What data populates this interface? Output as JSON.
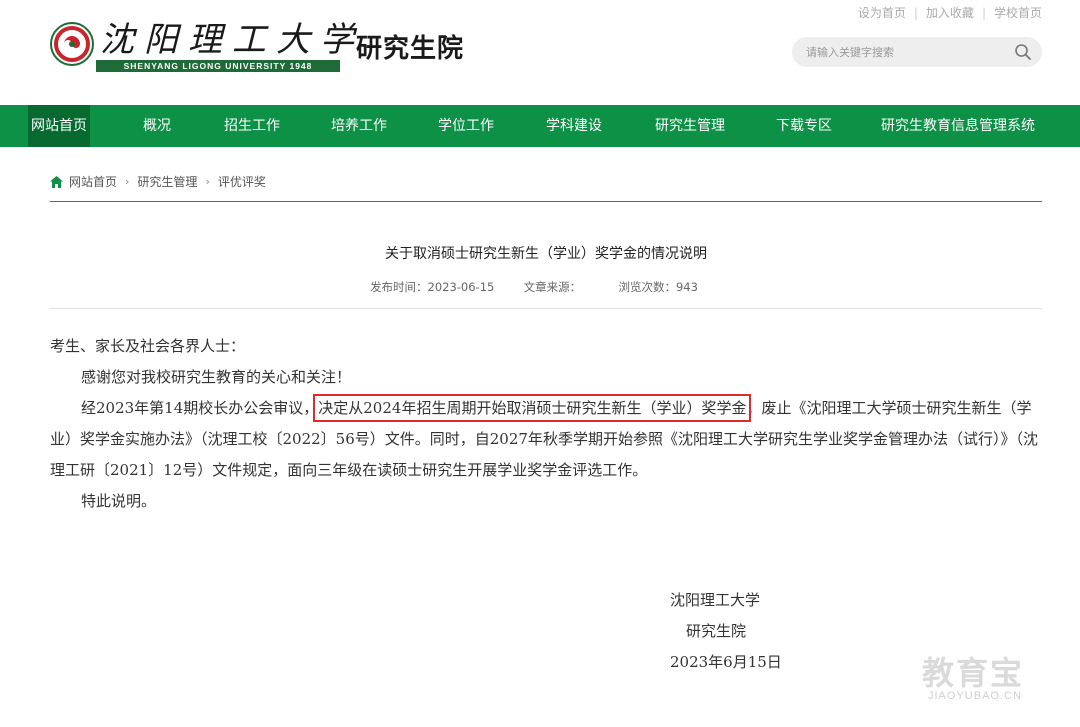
{
  "top_links": [
    "设为首页",
    "加入收藏",
    "学校首页"
  ],
  "logo": {
    "cn": "沈阳理工大学",
    "en": "SHENYANG LIGONG UNIVERSITY 1948",
    "emblem": "university-emblem"
  },
  "site_name": "研究生院",
  "search": {
    "placeholder": "请输入关键字搜索",
    "icon": "search-icon"
  },
  "colors": {
    "nav_green": "#0d9146",
    "nav_active": "#076a31",
    "highlight_red": "#e12b2b"
  },
  "nav": {
    "items": [
      "网站首页",
      "概况",
      "招生工作",
      "培养工作",
      "学位工作",
      "学科建设",
      "研究生管理",
      "下载专区",
      "研究生教育信息管理系统"
    ],
    "active": "网站首页"
  },
  "breadcrumb": {
    "icon": "home-icon",
    "items": [
      "网站首页",
      "研究生管理",
      "评优评奖"
    ]
  },
  "article": {
    "title": "关于取消硕士研究生新生（学业）奖学金的情况说明",
    "publish_time": "发布时间：2023-06-15",
    "source": "文章来源：",
    "views": "浏览次数：943",
    "salutation": "考生、家长及社会各界人士：",
    "para1": "感谢您对我校研究生教育的关心和关注！",
    "para2_pre": "经2023年第14期校长办公会审议，",
    "para2_highlight": "决定从2024年招生周期开始取消硕士研究生新生（学业）奖学金",
    "para2_post": "，废止《沈阳理工大学硕士研究生新生（学业）奖学金实施办法》（沈理工校〔2022〕56号）文件。同时，自2027年秋季学期开始参照《沈阳理工大学研究生学业奖学金管理办法（试行）》（沈理工研〔2021〕12号）文件规定，面向三年级在读硕士研究生开展学业奖学金评选工作。",
    "para3": "特此说明。",
    "sign_org": "沈阳理工大学",
    "sign_dept": "研究生院",
    "sign_date": "2023年6月15日"
  },
  "watermark": {
    "cn": "教育宝",
    "en": "JIAOYUBAO.CN"
  }
}
